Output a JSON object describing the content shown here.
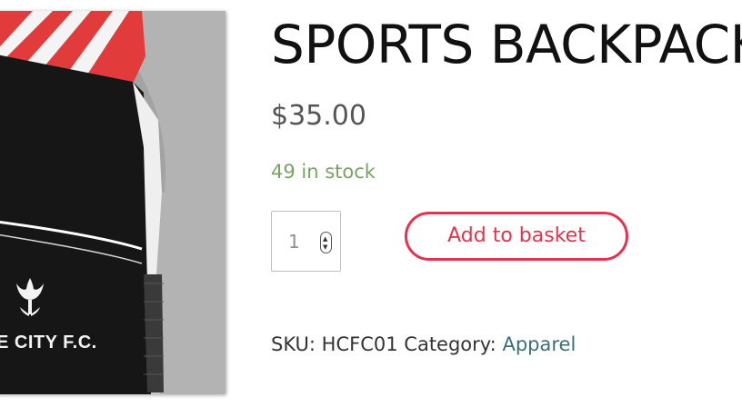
{
  "product": {
    "title": "SPORTS BACKPACK",
    "price": "$35.00",
    "stock": "49 in stock",
    "image": {
      "crest_text": "E CITY F.C.",
      "colors": {
        "bag_black": "#161616",
        "stripe_red": "#e23b3b",
        "stripe_white": "#f4f4f4",
        "shirt_gray": "#b9b9b9"
      }
    }
  },
  "cart": {
    "quantity": "1",
    "add_button_label": "Add to basket"
  },
  "meta": {
    "sku_label": "SKU:",
    "sku": "HCFC01",
    "category_label": "Category:",
    "category": "Apparel"
  },
  "colors": {
    "accent": "#e4334e",
    "stock_green": "#77a464",
    "link": "#3a6f7a",
    "price_gray": "#555555"
  },
  "icons": {
    "quantity_stepper": "up-down-spinner-icon",
    "crest": "tulip-crest-icon"
  }
}
